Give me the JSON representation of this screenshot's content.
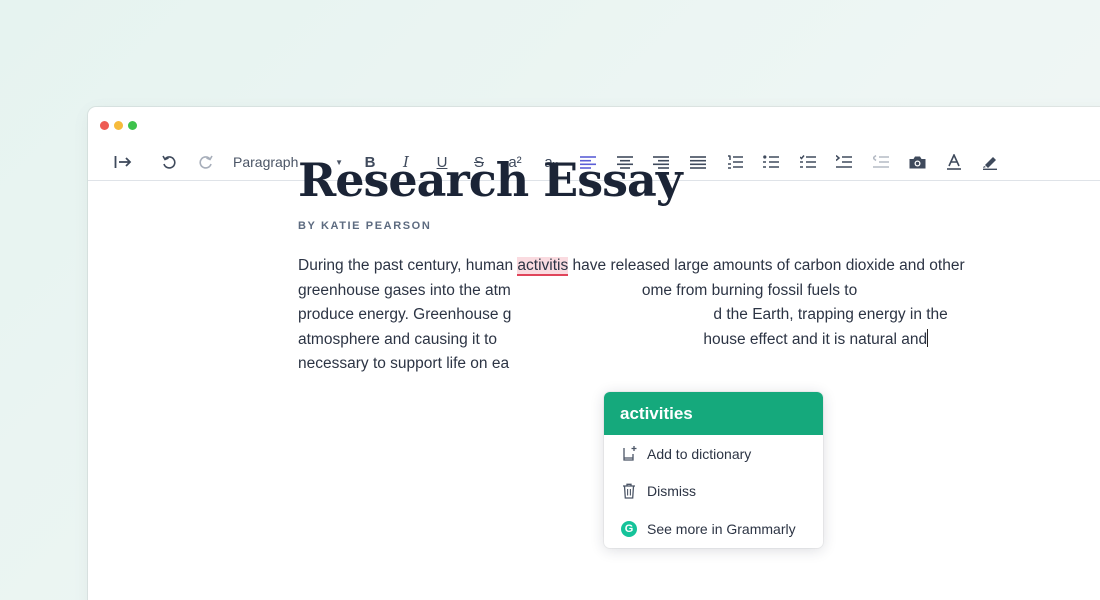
{
  "toolbar": {
    "paragraph_select": "Paragraph",
    "buttons": [
      {
        "name": "indent-toggle",
        "icon": "indent-arrow-icon"
      },
      {
        "name": "undo",
        "icon": "undo-icon"
      },
      {
        "name": "redo",
        "icon": "redo-icon"
      },
      {
        "name": "bold",
        "label": "B"
      },
      {
        "name": "italic",
        "label": "I"
      },
      {
        "name": "underline",
        "label": "U"
      },
      {
        "name": "strikethrough",
        "label": "S"
      },
      {
        "name": "superscript",
        "label": "a²"
      },
      {
        "name": "subscript",
        "label": "aₓ"
      }
    ],
    "accent_color": "#5b5fd6"
  },
  "document": {
    "title": "Research Essay",
    "byline": "BY KATIE PEARSON",
    "lines": [
      {
        "before": "During the past century, human ",
        "error": "activitis",
        "after": " have released large amounts of carbon dioxide and other"
      },
      {
        "left": "greenhouse gases into the atm",
        "right": "ome from burning fossil fuels to"
      },
      {
        "left": "produce energy. Greenhouse g",
        "right": "d the Earth, trapping energy in the"
      },
      {
        "left": "atmosphere and causing it to ",
        "right": "house effect and it is natural and"
      },
      {
        "left": "necessary to support life on ea",
        "right": ""
      }
    ]
  },
  "suggestion": {
    "replacement": "activities",
    "add_to_dictionary": "Add to dictionary",
    "dismiss": "Dismiss",
    "see_more": "See more in Grammarly",
    "brand_color": "#15a97c"
  }
}
